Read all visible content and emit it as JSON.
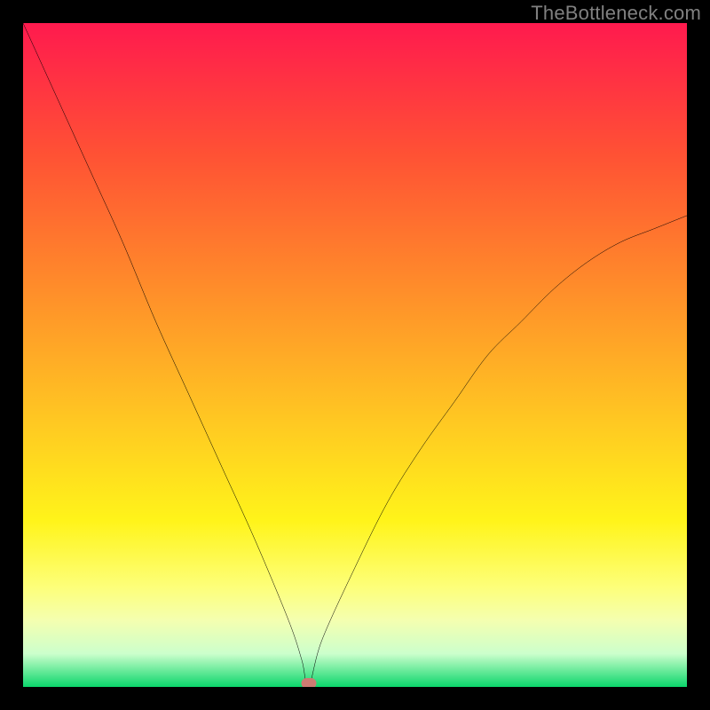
{
  "watermark": "TheBottleneck.com",
  "chart_data": {
    "type": "line",
    "title": "",
    "xlabel": "",
    "ylabel": "",
    "xlim": [
      0,
      100
    ],
    "ylim": [
      0,
      100
    ],
    "grid": false,
    "legend": false,
    "series": [
      {
        "name": "curve",
        "x": [
          0,
          5,
          10,
          15,
          20,
          25,
          30,
          35,
          40,
          42,
          43,
          45,
          50,
          55,
          60,
          65,
          70,
          75,
          80,
          85,
          90,
          95,
          100
        ],
        "values": [
          100,
          89,
          78,
          67,
          55,
          44,
          33,
          22,
          10,
          4,
          0,
          7,
          18,
          28,
          36,
          43,
          50,
          55,
          60,
          64,
          67,
          69,
          71
        ]
      }
    ],
    "markers": [
      {
        "name": "min-point",
        "x": 43,
        "y": 0.5
      }
    ],
    "background_gradient": {
      "direction": "top-to-bottom",
      "stops": [
        {
          "pos": 0,
          "color": "#ff1a4e"
        },
        {
          "pos": 20,
          "color": "#ff5234"
        },
        {
          "pos": 40,
          "color": "#ff8d2a"
        },
        {
          "pos": 60,
          "color": "#ffc822"
        },
        {
          "pos": 75,
          "color": "#fff41a"
        },
        {
          "pos": 85,
          "color": "#fdff7a"
        },
        {
          "pos": 90,
          "color": "#f4ffb0"
        },
        {
          "pos": 95,
          "color": "#ccffcc"
        },
        {
          "pos": 100,
          "color": "#0bd66b"
        }
      ]
    }
  }
}
